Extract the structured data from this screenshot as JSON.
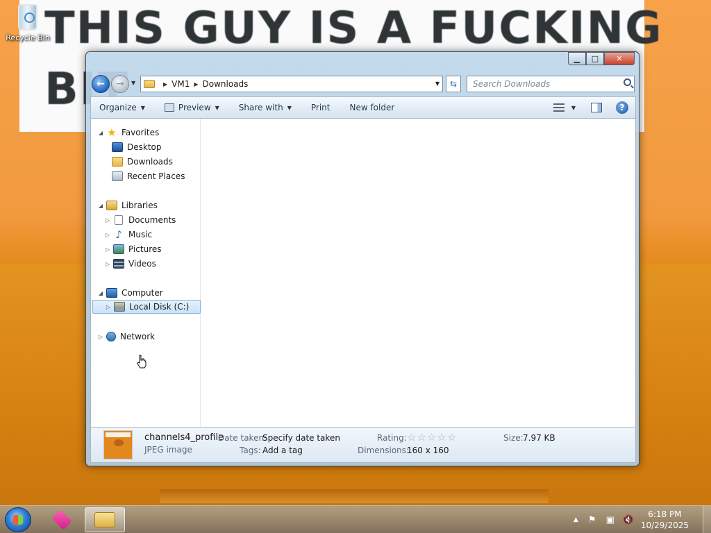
{
  "desktop": {
    "sign_line_1": "THIS GUY IS A FUCKING",
    "sign_line_2": "BIT",
    "icons": [
      {
        "label": "Recycle Bin",
        "icon": "recycle-bin-icon"
      }
    ]
  },
  "window": {
    "buttons": {
      "minimize": "▁",
      "maximize": "□",
      "close": "✕"
    },
    "address": {
      "crumbs": [
        "VM1",
        "Downloads"
      ]
    },
    "search": {
      "placeholder": "Search Downloads"
    },
    "toolbar": {
      "organize": "Organize",
      "preview": "Preview",
      "share_with": "Share with",
      "print": "Print",
      "new_folder": "New folder"
    },
    "nav_pane": {
      "favorites": {
        "label": "Favorites",
        "items": [
          "Desktop",
          "Downloads",
          "Recent Places"
        ]
      },
      "libraries": {
        "label": "Libraries",
        "items": [
          "Documents",
          "Music",
          "Pictures",
          "Videos"
        ]
      },
      "computer": {
        "label": "Computer",
        "items": [
          "Local Disk (C:)"
        ]
      },
      "network": {
        "label": "Network"
      }
    },
    "details": {
      "file_name": "channels4_profile",
      "file_type": "JPEG image",
      "date_taken_label": "Date taken:",
      "date_taken_value": "Specify date taken",
      "tags_label": "Tags:",
      "tags_value": "Add a tag",
      "rating_label": "Rating:",
      "rating_value": 0,
      "dimensions_label": "Dimensions:",
      "dimensions_value": "160 x 160",
      "size_label": "Size:",
      "size_value": "7.97 KB"
    }
  },
  "taskbar": {
    "clock_time": "6:18 PM",
    "clock_date": "10/29/2025"
  }
}
